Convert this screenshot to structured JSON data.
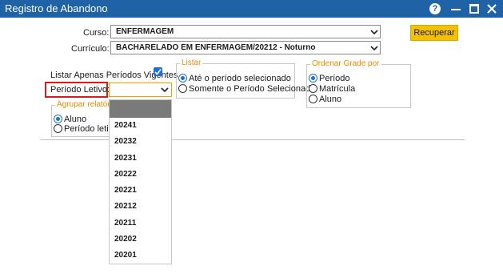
{
  "window": {
    "title": "Registro de Abandono",
    "help_icon": "question-circle-icon",
    "minimize_icon": "minimize-icon",
    "maximize_icon": "maximize-icon",
    "close_icon": "close-icon"
  },
  "form": {
    "curso_label": "Curso:",
    "curso_value": "ENFERMAGEM",
    "curriculo_label": "Currículo:",
    "curriculo_value": "BACHARELADO EM ENFERMAGEM/20212 - Noturno",
    "recuperar_label": "Recuperar",
    "listar_vigentes_label": "Listar Apenas Períodos Vigentes",
    "listar_vigentes_checked": true,
    "periodo_label": "Período Letivo:",
    "periodo_value": ""
  },
  "listar": {
    "legend": "Listar",
    "options": [
      "Até o período selecionado",
      "Somente o Período Selecionado"
    ],
    "selected": 0
  },
  "ordenar": {
    "legend": "Ordenar Grade por",
    "options": [
      "Período",
      "Matrícula",
      "Aluno"
    ],
    "selected": 0
  },
  "agrupar": {
    "legend": "Agrupar relatório",
    "options": [
      "Aluno",
      "Período letivo"
    ],
    "selected": 0
  },
  "periodo_dropdown": {
    "options": [
      "",
      "20241",
      "20232",
      "20231",
      "20222",
      "20221",
      "20212",
      "20211",
      "20202",
      "20201"
    ]
  },
  "colors": {
    "titlebar": "#1f63a6",
    "accent_orange": "#f08a00",
    "button_yellow": "#f5c000",
    "highlight_red": "#d11f1f"
  }
}
